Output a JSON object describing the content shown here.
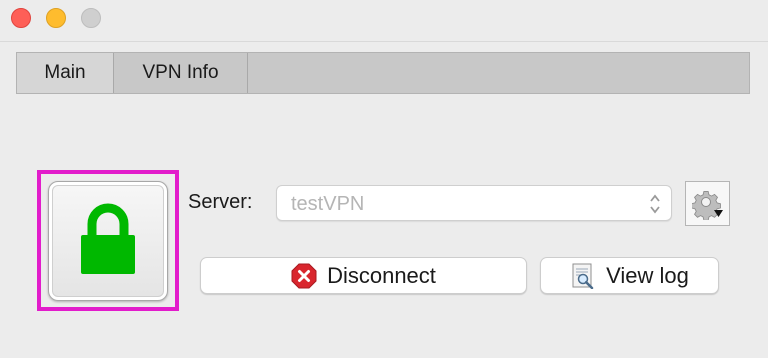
{
  "window": {
    "traffic_lights": [
      "close",
      "minimize",
      "zoom"
    ]
  },
  "tabs": [
    {
      "label": "Main",
      "selected": true
    },
    {
      "label": "VPN Info",
      "selected": false
    }
  ],
  "lock_button": {
    "icon": "padlock-icon",
    "state": "connected",
    "color": "#00b800"
  },
  "server": {
    "label": "Server:",
    "value": "testVPN"
  },
  "buttons": {
    "disconnect": {
      "label": "Disconnect",
      "icon": "stop-icon"
    },
    "view_log": {
      "label": "View log",
      "icon": "log-icon"
    },
    "settings": {
      "icon": "gear-icon"
    }
  },
  "colors": {
    "highlight": "#e21ccb",
    "lock_green": "#00b800",
    "stop_red": "#d9262e"
  }
}
